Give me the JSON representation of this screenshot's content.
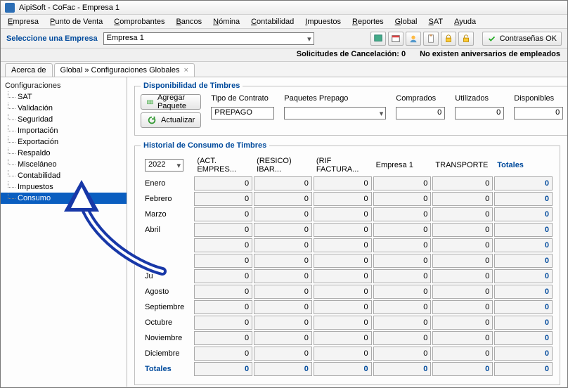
{
  "title": "AipiSoft - CoFac - Empresa 1",
  "menu": [
    "Empresa",
    "Punto de Venta",
    "Comprobantes",
    "Bancos",
    "Nómina",
    "Contabilidad",
    "Impuestos",
    "Reportes",
    "Global",
    "SAT",
    "Ayuda"
  ],
  "toolbar": {
    "select_label": "Seleccione una Empresa",
    "company": "Empresa 1",
    "contrasenas": "Contraseñas OK"
  },
  "status": {
    "cancel": "Solicitudes de Cancelación: 0",
    "aniv": "No existen aniversarios de empleados"
  },
  "tabs": {
    "about": "Acerca de",
    "global": "Global » Configuraciones Globales"
  },
  "sidebar": {
    "header": "Configuraciones",
    "items": [
      "SAT",
      "Validación",
      "Seguridad",
      "Importación",
      "Exportación",
      "Respaldo",
      "Misceláneo",
      "Contabilidad",
      "Impuestos",
      "Consumo"
    ],
    "selected_index": 9
  },
  "disp": {
    "legend": "Disponibilidad de Timbres",
    "agregar": "Agregar Paquete",
    "actualizar": "Actualizar",
    "tipo_label": "Tipo de Contrato",
    "tipo_value": "PREPAGO",
    "paquetes_label": "Paquetes Prepago",
    "paquetes_value": "",
    "comprados_label": "Comprados",
    "comprados_value": "0",
    "utilizados_label": "Utilizados",
    "utilizados_value": "0",
    "disponibles_label": "Disponibles",
    "disponibles_value": "0"
  },
  "hist": {
    "legend": "Historial de Consumo de Timbres",
    "year": "2022",
    "cols": [
      "(ACT. EMPRES...",
      "(RESICO) IBAR...",
      "(RIF FACTURA...",
      "Empresa 1",
      "TRANSPORTE",
      "Totales"
    ],
    "rows": [
      {
        "m": "Enero",
        "v": [
          0,
          0,
          0,
          0,
          0,
          0
        ]
      },
      {
        "m": "Febrero",
        "v": [
          0,
          0,
          0,
          0,
          0,
          0
        ]
      },
      {
        "m": "Marzo",
        "v": [
          0,
          0,
          0,
          0,
          0,
          0
        ]
      },
      {
        "m": "Abril",
        "v": [
          0,
          0,
          0,
          0,
          0,
          0
        ]
      },
      {
        "m": "",
        "v": [
          0,
          0,
          0,
          0,
          0,
          0
        ]
      },
      {
        "m": "",
        "v": [
          0,
          0,
          0,
          0,
          0,
          0
        ]
      },
      {
        "m": "Ju",
        "v": [
          0,
          0,
          0,
          0,
          0,
          0
        ]
      },
      {
        "m": "Agosto",
        "v": [
          0,
          0,
          0,
          0,
          0,
          0
        ]
      },
      {
        "m": "Septiembre",
        "v": [
          0,
          0,
          0,
          0,
          0,
          0
        ]
      },
      {
        "m": "Octubre",
        "v": [
          0,
          0,
          0,
          0,
          0,
          0
        ]
      },
      {
        "m": "Noviembre",
        "v": [
          0,
          0,
          0,
          0,
          0,
          0
        ]
      },
      {
        "m": "Diciembre",
        "v": [
          0,
          0,
          0,
          0,
          0,
          0
        ]
      }
    ],
    "totals_label": "Totales",
    "totals": [
      0,
      0,
      0,
      0,
      0,
      0
    ]
  }
}
